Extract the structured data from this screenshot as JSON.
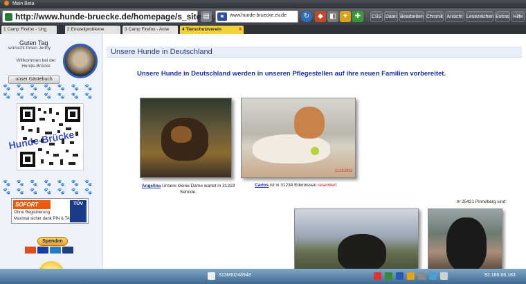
{
  "window": {
    "title": "Mein Beta"
  },
  "navbar": {
    "url": "http://www.hunde-bruecke.de/homepage/s_sites.p...",
    "search_value": "www.hunde-bruecke.ev.de",
    "menu": [
      "CSS",
      "Datei",
      "Bearbeiten",
      "Chronik",
      "Ansicht",
      "Lesezeichen",
      "Extras",
      "Hilfe"
    ]
  },
  "tabs": [
    {
      "label": "1 Camp Firefox - Ung"
    },
    {
      "label": "2 Einstellprobleme"
    },
    {
      "label": "3 Camp Firefox - Antw"
    },
    {
      "label": "4 Tierschutzverein"
    }
  ],
  "sidebar": {
    "greeting": "Guten Tag",
    "greeting_sub": "wünscht Ihnen Jenny",
    "welcome": "Willkommen bei der Hunde-Brücke",
    "guestbook_label": "unser Gästebuch",
    "qr_text": "Hunde-Brücke",
    "sofort_logo": "SOFORT",
    "sofort_line1": "Ohne Registrierung",
    "sofort_line2": "Maximal sicher dank PIN & TAN",
    "tuv_label": "TÜV",
    "donate_label": "Spenden"
  },
  "main": {
    "heading": "Unsere Hunde in Deutschland",
    "intro": "Unsere Hunde in Deutschland werden in unseren Pflegestellen auf ihre neuen Familien vorbereitet.",
    "dogs": [
      {
        "name": "Angelina",
        "text": "Unsere kleine Dame wartet in 31319 Sehnde."
      },
      {
        "name": "Carlos",
        "text": "ist in 31234 Edemissen",
        "status": "reserviert",
        "photo_date": "21.10.2012"
      }
    ],
    "location_caption": "In 25421 Pinneberg sind:"
  },
  "taskbar": {
    "status_text": "313M8I248948",
    "clock": "92.186.68.183"
  }
}
